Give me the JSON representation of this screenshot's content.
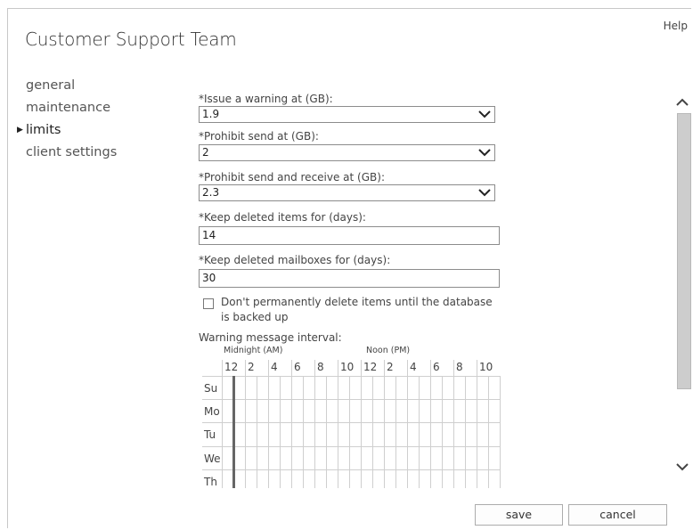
{
  "header": {
    "title": "Customer Support Team",
    "help_label": "Help"
  },
  "nav": {
    "items": [
      {
        "label": "general"
      },
      {
        "label": "maintenance"
      },
      {
        "label": "limits"
      },
      {
        "label": "client settings"
      }
    ]
  },
  "limits": {
    "warning": {
      "label": "*Issue a warning at (GB):",
      "value": "1.9"
    },
    "prohibit_send": {
      "label": "*Prohibit send at (GB):",
      "value": "2"
    },
    "prohibit_send_receive": {
      "label": "*Prohibit send and receive at (GB):",
      "value": "2.3"
    },
    "keep_items": {
      "label": "*Keep deleted items for (days):",
      "value": "14"
    },
    "keep_mailboxes": {
      "label": "*Keep deleted mailboxes for (days):",
      "value": "30"
    },
    "backup_checkbox": {
      "line1": "Don't permanently delete items until the database",
      "line2": "is backed up",
      "checked": false
    },
    "interval": {
      "label": "Warning message interval:",
      "midnight_label": "Midnight (AM)",
      "noon_label": "Noon (PM)",
      "hours": [
        "12",
        "2",
        "4",
        "6",
        "8",
        "10",
        "12",
        "2",
        "4",
        "6",
        "8",
        "10"
      ],
      "days": [
        "Su",
        "Mo",
        "Tu",
        "We",
        "Th"
      ]
    }
  },
  "footer": {
    "save_label": "save",
    "cancel_label": "cancel"
  },
  "icons": {
    "dropdown": "chevron-down-icon",
    "scroll_up": "chevron-up-icon",
    "scroll_down": "chevron-down-icon",
    "nav_active": "triangle-right-icon"
  }
}
